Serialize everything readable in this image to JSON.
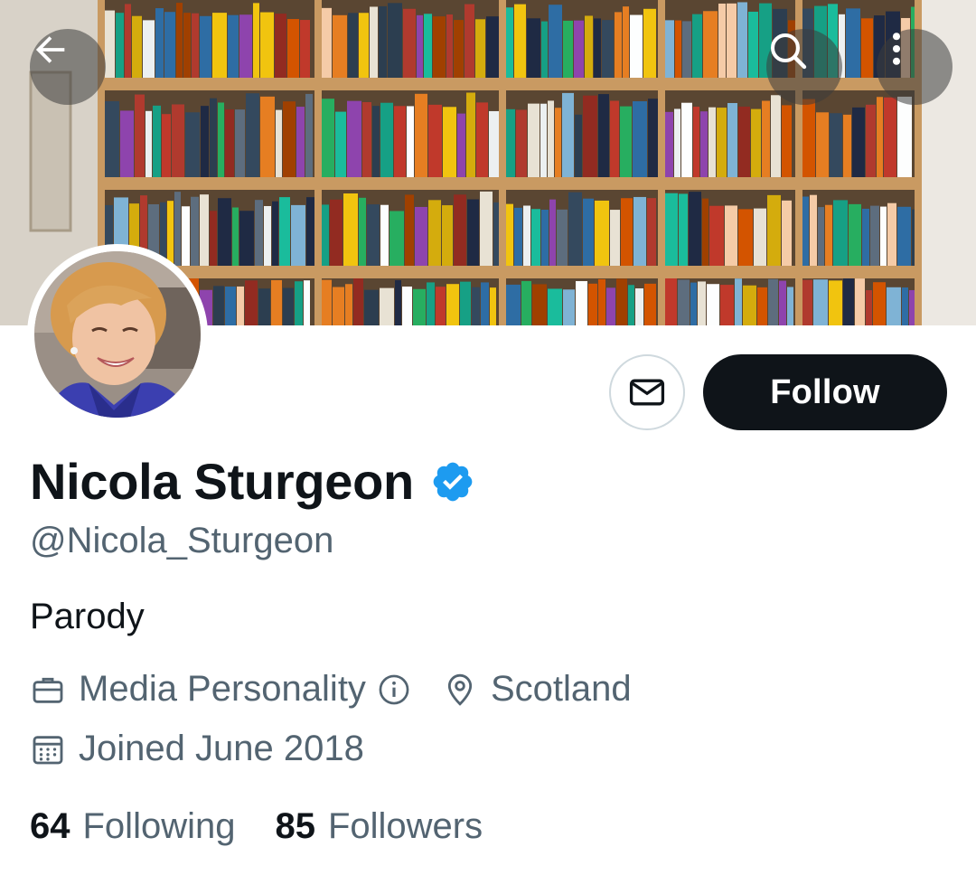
{
  "banner": {
    "subject": "bookshelf photo"
  },
  "header": {
    "back_icon": "arrow-left-icon",
    "search_icon": "search-icon",
    "more_icon": "more-vertical-icon"
  },
  "profile": {
    "display_name": "Nicola Sturgeon",
    "verified": true,
    "handle": "@Nicola_Sturgeon",
    "bio": "Parody",
    "category": "Media Personality",
    "location": "Scotland",
    "joined": "Joined June 2018",
    "following_count": "64",
    "following_label": "Following",
    "followers_count": "85",
    "followers_label": "Followers"
  },
  "actions": {
    "message_icon": "envelope-icon",
    "follow_label": "Follow"
  },
  "colors": {
    "primary_text": "#0f1419",
    "secondary_text": "#536471",
    "verified_blue": "#1d9bf0",
    "follow_bg": "#0f1419"
  }
}
